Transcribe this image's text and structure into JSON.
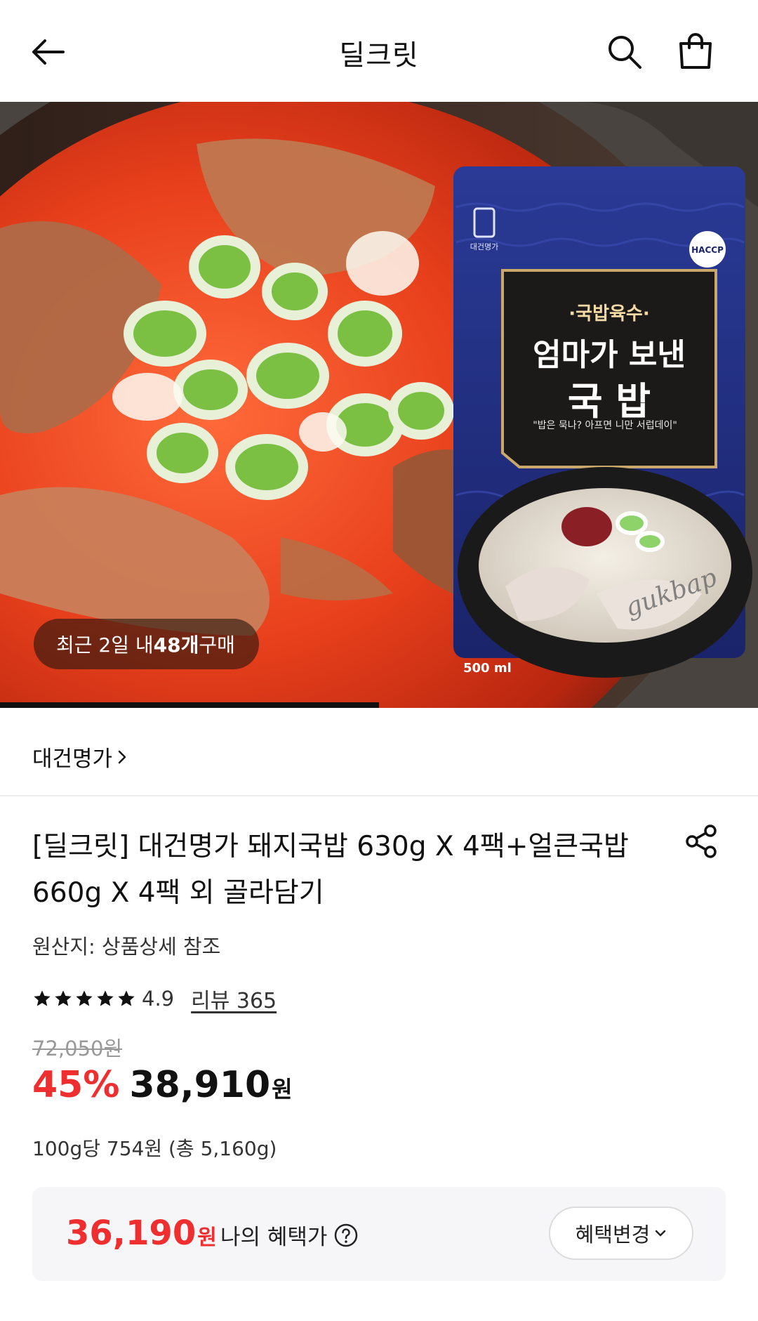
{
  "header": {
    "title": "딜크릿",
    "back_icon": "arrow-left-icon",
    "search_icon": "search-icon",
    "cart_icon": "shopping-bag-icon"
  },
  "hero": {
    "badge_prefix": "최근 2일 내 ",
    "badge_count": "48개",
    "badge_suffix": " 구매",
    "package": {
      "small_label": "·국밥육수·",
      "headline_1": "엄마가 보낸",
      "headline_2": "국 밥",
      "tagline": "\"밥은 묵나? 아프면 니만 서럽데이\"",
      "volume": "500 ml",
      "brand_mark": "대건명가",
      "cert": "HACCP",
      "script_text": "gukbap"
    },
    "slide_progress": 0.5
  },
  "brand": {
    "name": "대건명가"
  },
  "product": {
    "title": "[딜크릿] 대건명가 돼지국밥 630g X 4팩+얼큰국밥 660g X 4팩 외 골라담기",
    "origin": "원산지: 상품상세 참조",
    "rating": "4.9",
    "rating_stars": 5,
    "review_link": "리뷰 365",
    "original_price": "72,050원",
    "discount": "45%",
    "sale_price": "38,910",
    "sale_unit": "원",
    "unit_price": "100g당 754원 (총 5,160g)"
  },
  "benefit": {
    "amount": "36,190",
    "unit": "원",
    "label": "나의 혜택가",
    "change_button": "혜택변경"
  },
  "colors": {
    "accent_red": "#ef2f2f",
    "package_navy": "#1f2c7a"
  }
}
